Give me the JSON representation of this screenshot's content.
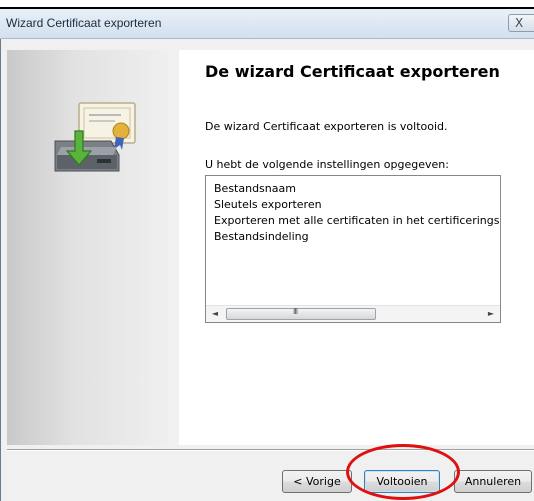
{
  "window": {
    "title": "Wizard Certificaat exporteren",
    "close_label": "X"
  },
  "main": {
    "heading": "De wizard Certificaat exporteren",
    "complete_text": "De wizard Certificaat exporteren is voltooid.",
    "settings_label": "U hebt de volgende instellingen opgegeven:",
    "settings_items": [
      "Bestandsnaam",
      "Sleutels exporteren",
      "Exporteren met alle certificaten in het certificeringspad",
      "Bestandsindeling"
    ]
  },
  "scrollbar": {
    "left_arrow": "◄",
    "right_arrow": "►",
    "grip": "III"
  },
  "buttons": {
    "back": "< Vorige",
    "finish": "Voltooien",
    "cancel": "Annuleren"
  },
  "colors": {
    "highlight": "#e01010",
    "titlebar": "#dbe6f3",
    "window_bg": "#f0f0f0"
  },
  "icons": [
    "certificate-export-icon",
    "close-icon"
  ]
}
